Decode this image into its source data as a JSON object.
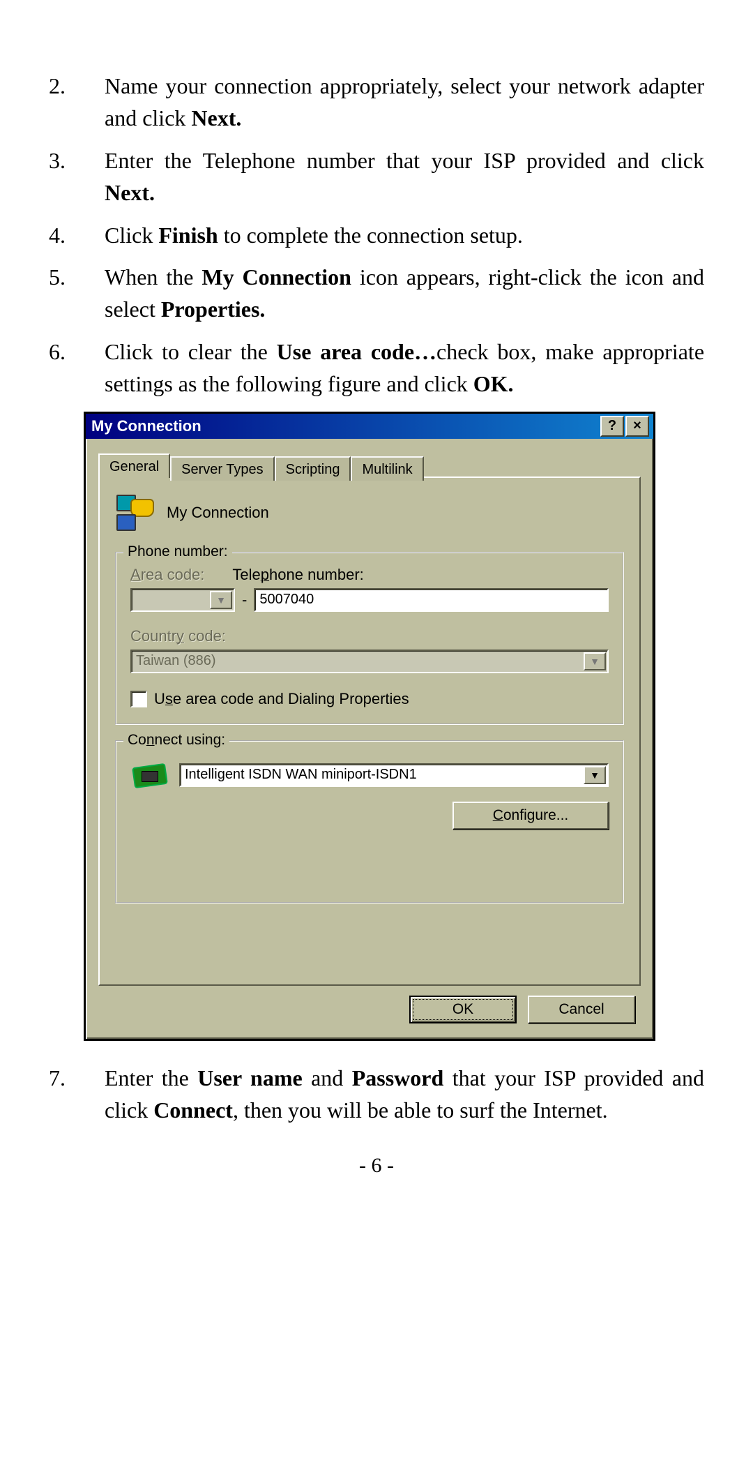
{
  "steps": {
    "s2": {
      "num": "2.",
      "a": "Name your connection appropriately, select your network adapter and click ",
      "b": "Next."
    },
    "s3": {
      "num": "3.",
      "a": "Enter the Telephone number that your ISP provided and click ",
      "b": "Next."
    },
    "s4": {
      "num": "4.",
      "a": "Click ",
      "b": "Finish",
      "c": " to complete the connection setup."
    },
    "s5": {
      "num": "5.",
      "a": "When the ",
      "b": "My Connection",
      "c": " icon appears, right-click the icon and select ",
      "d": "Properties."
    },
    "s6": {
      "num": "6.",
      "a": "Click to clear the ",
      "b": "Use area code…",
      "c": "check box, make appropriate settings as the following figure and click ",
      "d": "OK."
    },
    "s7": {
      "num": "7.",
      "a": "Enter the ",
      "b": "User name",
      "c": " and ",
      "d": "Password",
      "e": " that your ISP provided and click ",
      "f": "Connect",
      "g": ", then you will be able to surf the Internet."
    }
  },
  "dialog": {
    "title": "My Connection",
    "help_btn": "?",
    "close_btn": "×",
    "tabs": {
      "general": "General",
      "server": "Server Types",
      "scripting": "Scripting",
      "multilink": "Multilink"
    },
    "conn_name": "My Connection",
    "phone_group_title": "Phone number:",
    "area_code_label_pre": "A",
    "area_code_label_post": "rea code:",
    "telephone_label_pre": "Tele",
    "telephone_label_u": "p",
    "telephone_label_post": "hone number:",
    "area_code_value": "",
    "dash": "-",
    "telephone_value": "5007040",
    "country_label_pre": "Countr",
    "country_label_u": "y",
    "country_label_post": " code:",
    "country_value": "Taiwan (886)",
    "use_area_pre": "U",
    "use_area_u": "s",
    "use_area_post": "e area code and Dialing Properties",
    "connect_group_pre": "Co",
    "connect_group_u": "n",
    "connect_group_post": "nect using:",
    "modem_value": "Intelligent ISDN WAN miniport-ISDN1",
    "configure_u": "C",
    "configure_post": "onfigure...",
    "ok": "OK",
    "cancel": "Cancel"
  },
  "page_number": "- 6 -"
}
